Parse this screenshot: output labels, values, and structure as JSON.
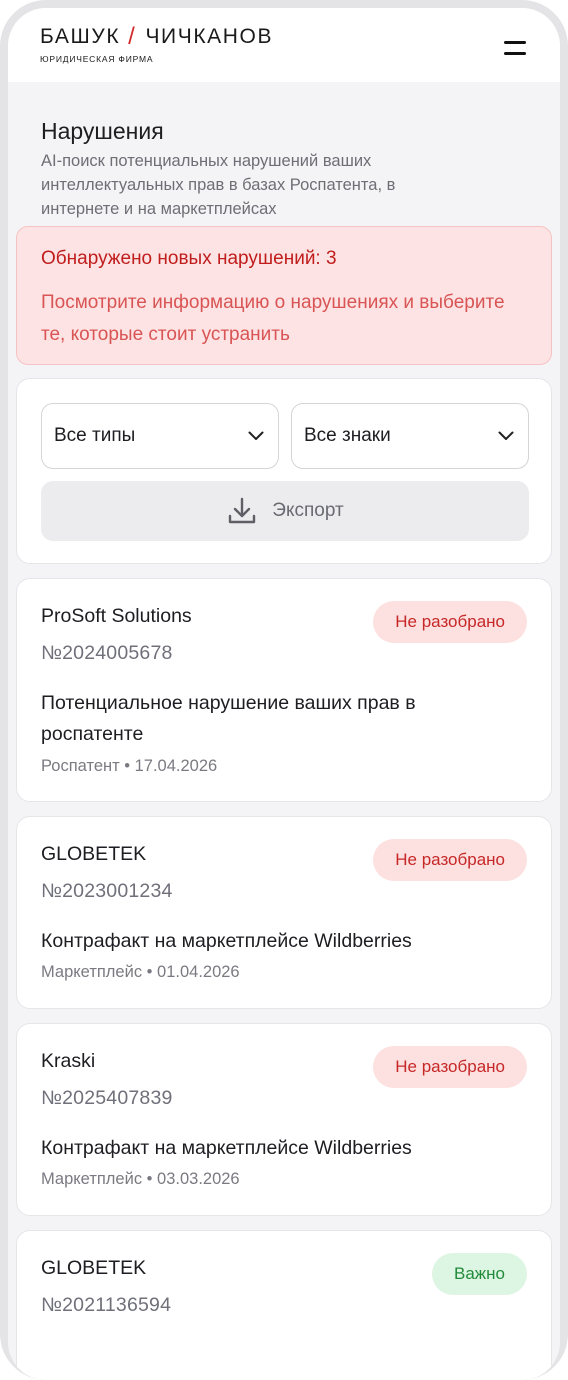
{
  "header": {
    "logo_left": "БАШУК",
    "logo_slash": "/",
    "logo_right": "ЧИЧКАНОВ",
    "logo_subtitle": "ЮРИДИЧЕСКАЯ ФИРМА",
    "menu_icon": "hamburger-menu-icon"
  },
  "page": {
    "title": "Нарушения",
    "description": "AI-поиск потенциальных нарушений ваших интеллектуальных прав в базах Роспатента, в интернете и на маркетплейсах"
  },
  "alert": {
    "title": "Обнаружено новых нарушений: 3",
    "body": "Посмотрите информацию о нарушениях и выберите те, которые стоит устранить"
  },
  "filters": {
    "type_select": "Все типы",
    "mark_select": "Все знаки",
    "export_label": "Экспорт"
  },
  "violations": [
    {
      "name": "ProSoft Solutions",
      "number": "№2024005678",
      "status": "Не разобрано",
      "status_color": "#c62828",
      "description": "Потенциальное нарушение ваших прав в роспатенте",
      "meta": "Роспатент • 17.04.2026"
    },
    {
      "name": "GLOBETEK",
      "number": "№2023001234",
      "status": "Не разобрано",
      "status_color": "#c62828",
      "description": "Контрафакт на маркетплейсе Wildberries",
      "meta": "Маркетплейс • 01.04.2026"
    },
    {
      "name": "Kraski",
      "number": "№2025407839",
      "status": "Не разобрано",
      "status_color": "#c62828",
      "description": "Контрафакт на маркетплейсе Wildberries",
      "meta": "Маркетплейс • 03.03.2026"
    },
    {
      "name": "GLOBETEK",
      "number": "№2021136594",
      "status": "Важно",
      "status_color": "#228b3a"
    }
  ]
}
